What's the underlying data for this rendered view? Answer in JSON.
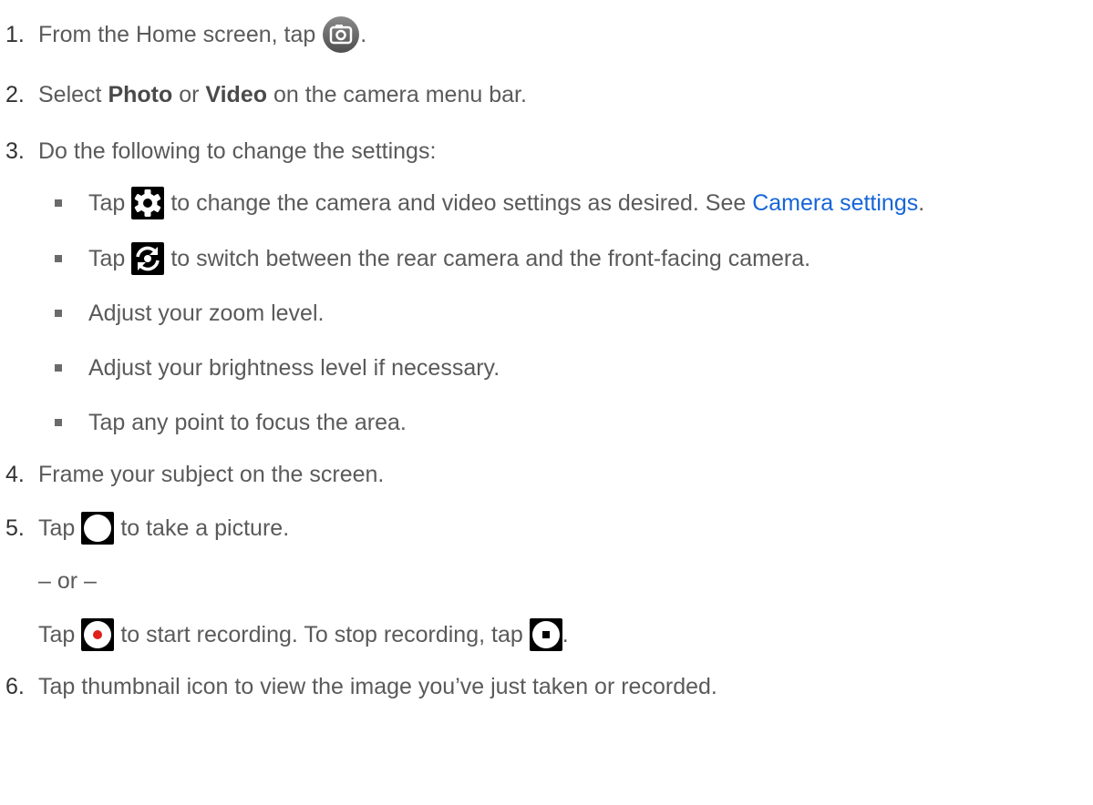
{
  "steps": [
    {
      "num": "1.",
      "before": "From the Home screen, tap",
      "icon": "camera-app-icon",
      "after": "."
    },
    {
      "num": "2.",
      "before": "Select ",
      "bold1": "Photo",
      "mid": " or ",
      "bold2": "Video",
      "after": " on the camera menu bar."
    },
    {
      "num": "3.",
      "text": "Do the following to change the settings:"
    },
    {
      "num": "4.",
      "text": "Frame your subject on the screen."
    },
    {
      "num": "5.",
      "before": "Tap",
      "icon": "shutter-icon",
      "after": "to take a picture."
    },
    {
      "num": "6.",
      "text": "Tap thumbnail icon to view the image you’ve just taken or recorded."
    }
  ],
  "substeps": [
    {
      "before": "Tap",
      "icon": "settings-gear-icon",
      "after": "to change the camera and video settings as desired. See ",
      "link": "Camera settings",
      "end": "."
    },
    {
      "before": "Tap",
      "icon": "switch-camera-icon",
      "after": "to switch between the rear camera and the front-facing camera."
    },
    {
      "text": "Adjust your zoom level."
    },
    {
      "text": "Adjust your brightness level if necessary."
    },
    {
      "text": "Tap any point to focus the area."
    }
  ],
  "or_text": "– or –",
  "record": {
    "before": "Tap",
    "icon1": "record-icon",
    "mid": "to start recording. To stop recording, tap",
    "icon2": "stop-icon",
    "after": "."
  },
  "colors": {
    "text": "#5a5a5a",
    "link": "#1565d8",
    "record_dot": "#e0201b"
  }
}
